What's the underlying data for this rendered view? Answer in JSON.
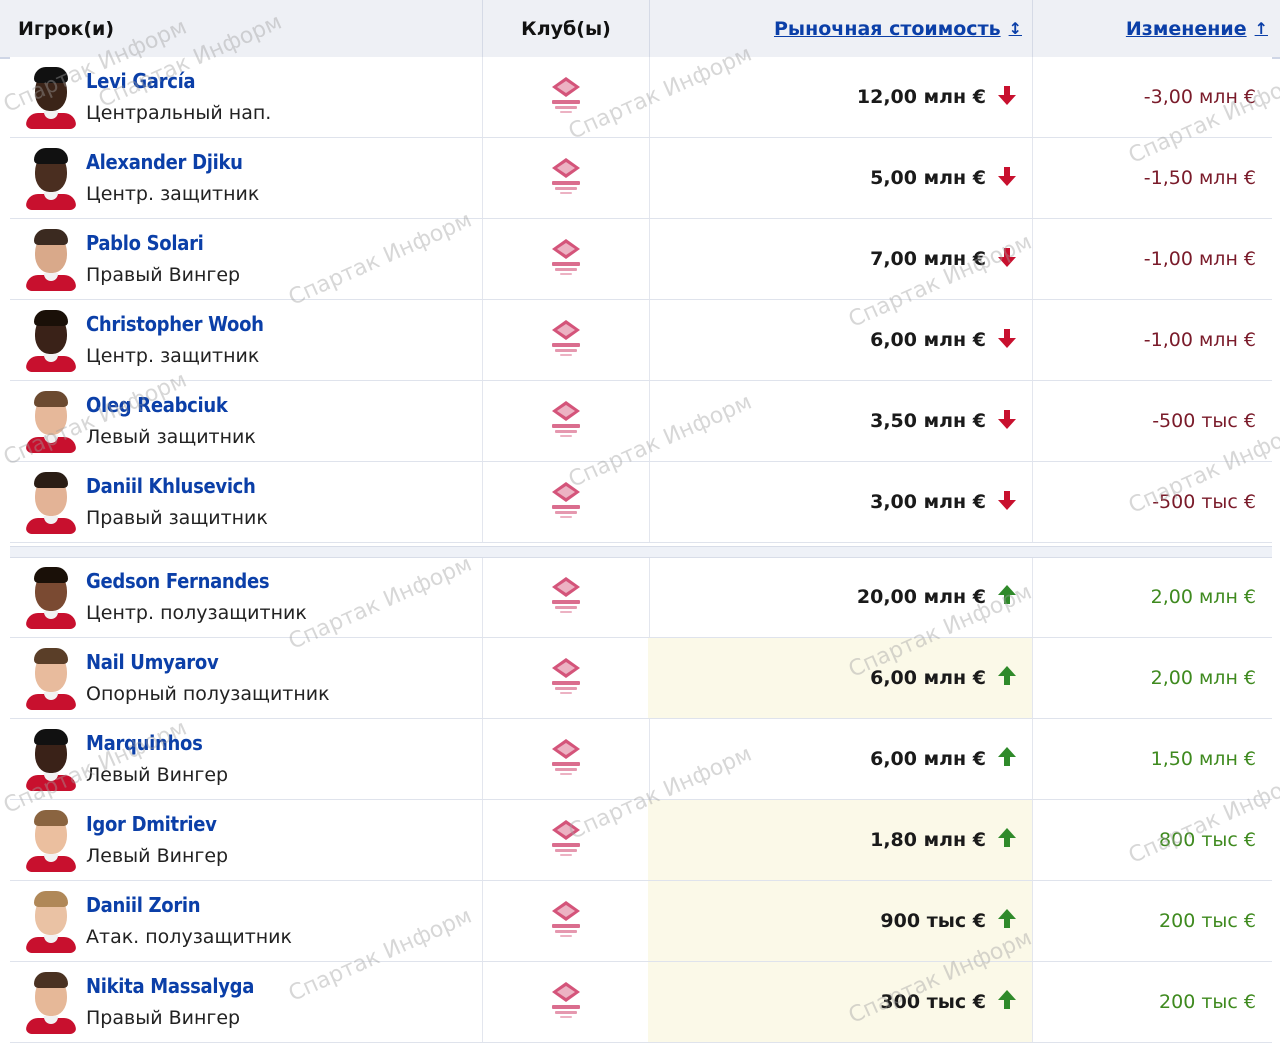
{
  "header": {
    "player": "Игрок(и)",
    "club": "Клуб(ы)",
    "market_value": "Рыночная стоимость",
    "market_value_icon": "↕",
    "change": "Изменение",
    "change_icon": "↑"
  },
  "rows": [
    {
      "name": "Levi García",
      "position": "Центральный нап.",
      "value": "12,00 млн €",
      "change": "-3,00 млн €",
      "trend": "down",
      "shaded": false,
      "skin": "#3b2418",
      "hair": "#111"
    },
    {
      "name": "Alexander Djiku",
      "position": "Центр. защитник",
      "value": "5,00 млн €",
      "change": "-1,50 млн €",
      "trend": "down",
      "shaded": false,
      "skin": "#4a2e20",
      "hair": "#111"
    },
    {
      "name": "Pablo Solari",
      "position": "Правый Вингер",
      "value": "7,00 млн €",
      "change": "-1,00 млн €",
      "trend": "down",
      "shaded": false,
      "skin": "#d9a98a",
      "hair": "#3b2a20"
    },
    {
      "name": "Christopher Wooh",
      "position": "Центр. защитник",
      "value": "6,00 млн €",
      "change": "-1,00 млн €",
      "trend": "down",
      "shaded": false,
      "skin": "#3a2218",
      "hair": "#1a1008"
    },
    {
      "name": "Oleg Reabciuk",
      "position": "Левый защитник",
      "value": "3,50 млн €",
      "change": "-500 тыс €",
      "trend": "down",
      "shaded": false,
      "skin": "#e6b89a",
      "hair": "#6b4a30"
    },
    {
      "name": "Daniil Khlusevich",
      "position": "Правый защитник",
      "value": "3,00 млн €",
      "change": "-500 тыс €",
      "trend": "down",
      "shaded": false,
      "skin": "#e3b396",
      "hair": "#2a1d15"
    },
    {
      "name": "Gedson Fernandes",
      "position": "Центр. полузащитник",
      "value": "20,00 млн €",
      "change": "2,00 млн €",
      "trend": "up",
      "shaded": false,
      "skin": "#7a4a32",
      "hair": "#1a1008"
    },
    {
      "name": "Nail Umyarov",
      "position": "Опорный полузащитник",
      "value": "6,00 млн €",
      "change": "2,00 млн €",
      "trend": "up",
      "shaded": true,
      "skin": "#e8bb9d",
      "hair": "#5a3e28"
    },
    {
      "name": "Marquinhos",
      "position": "Левый Вингер",
      "value": "6,00 млн €",
      "change": "1,50 млн €",
      "trend": "up",
      "shaded": false,
      "skin": "#3a2218",
      "hair": "#111"
    },
    {
      "name": "Igor Dmitriev",
      "position": "Левый Вингер",
      "value": "1,80 млн €",
      "change": "800 тыс €",
      "trend": "up",
      "shaded": true,
      "skin": "#ebbf9f",
      "hair": "#8a6440"
    },
    {
      "name": "Daniil Zorin",
      "position": "Атак. полузащитник",
      "value": "900 тыс €",
      "change": "200 тыс €",
      "trend": "up",
      "shaded": true,
      "skin": "#eac2a4",
      "hair": "#b08858"
    },
    {
      "name": "Nikita Massalyga",
      "position": "Правый Вингер",
      "value": "300 тыс €",
      "change": "200 тыс €",
      "trend": "up",
      "shaded": true,
      "skin": "#e6b898",
      "hair": "#4a3222"
    }
  ],
  "watermark": "Спартак Информ",
  "colors": {
    "link": "#0b3fa8",
    "down": "#7a1b2a",
    "down_arrow": "#c8102e",
    "up": "#3f8a1f",
    "up_arrow": "#2f8a2a",
    "shaded": "#fbf9e8",
    "club_logo": "#d4547a"
  }
}
